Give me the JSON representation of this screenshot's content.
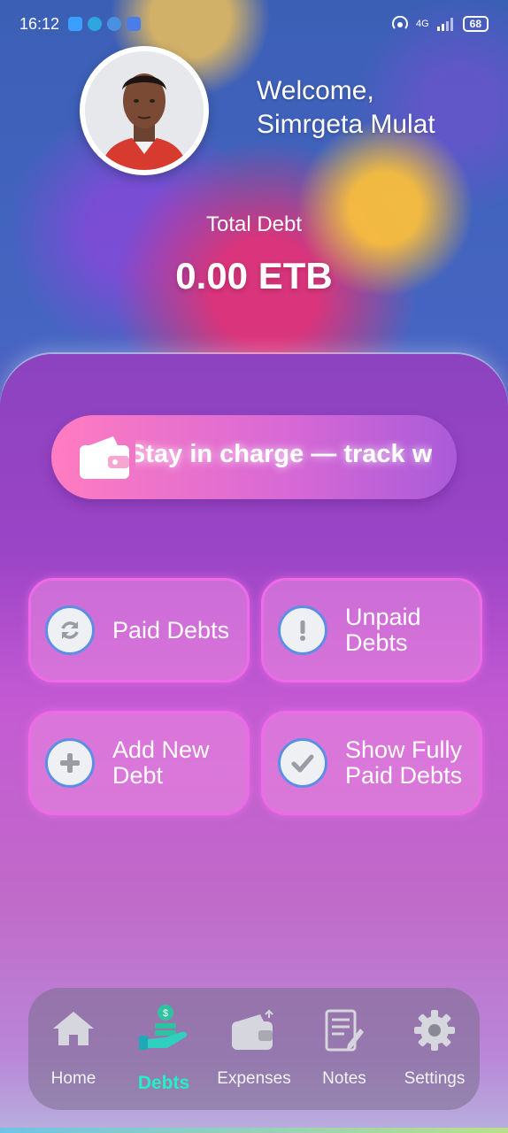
{
  "status_bar": {
    "time": "16:12",
    "network": "4G",
    "battery": "68"
  },
  "header": {
    "welcome_line1": "Welcome,",
    "welcome_line2": "Simrgeta Mulat"
  },
  "summary": {
    "label": "Total Debt",
    "value": "0.00 ETB"
  },
  "marquee": {
    "text": "Stay in charge — track w"
  },
  "actions": [
    {
      "label": "Paid Debts",
      "icon": "refresh-icon"
    },
    {
      "label": "Unpaid Debts",
      "icon": "exclamation-icon"
    },
    {
      "label": "Add New Debt",
      "icon": "plus-icon"
    },
    {
      "label": "Show Fully Paid Debts",
      "icon": "check-icon"
    }
  ],
  "nav": {
    "items": [
      {
        "label": "Home",
        "icon": "home-icon"
      },
      {
        "label": "Debts",
        "icon": "money-hand-icon",
        "active": true
      },
      {
        "label": "Expenses",
        "icon": "wallet-icon"
      },
      {
        "label": "Notes",
        "icon": "notes-icon"
      },
      {
        "label": "Settings",
        "icon": "gear-icon"
      }
    ]
  },
  "colors": {
    "active_nav": "#22f1c6",
    "card_border": "#ef6ae6",
    "icon_ring": "#5b8fe6"
  }
}
